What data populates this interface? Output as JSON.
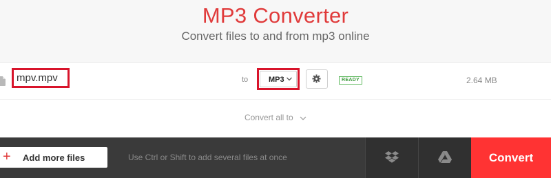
{
  "header": {
    "title": "MP3 Converter",
    "subtitle": "Convert files to and from mp3 online"
  },
  "file": {
    "name": "mpv.mpv",
    "to_label": "to",
    "format": "MP3",
    "status": "READY",
    "size": "2.64 MB"
  },
  "convert_all_label": "Convert all to",
  "bottom": {
    "add_files_label": "Add more files",
    "hint": "Use Ctrl or Shift to add several files at once",
    "convert_label": "Convert",
    "icons": [
      "dropbox-icon",
      "google-drive-icon"
    ]
  },
  "colors": {
    "accent": "#e03a3a",
    "convert_button": "#ff3333",
    "highlight_border": "#d8142b",
    "ready": "#5cb85c"
  }
}
